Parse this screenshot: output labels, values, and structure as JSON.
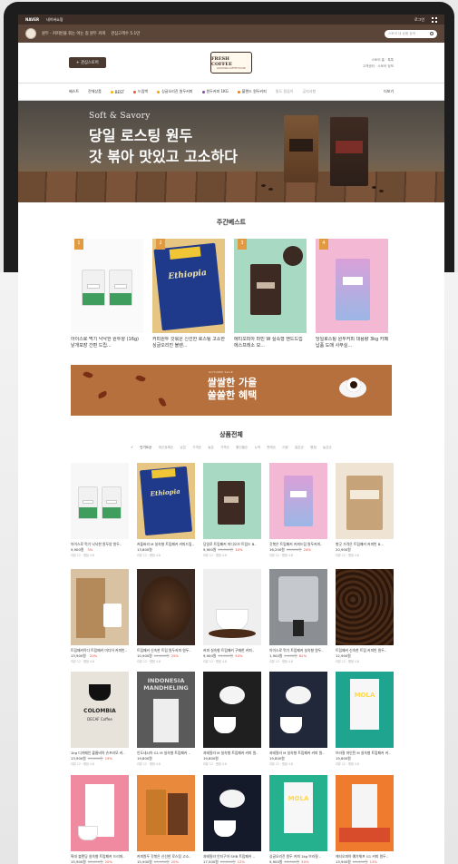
{
  "topbar": {
    "left_brand": "NAVER",
    "left_link": "네이버쇼핑",
    "right_link": "로그인"
  },
  "subbar": {
    "store_info": "원두 · 커피빈을 볶는 아는 길 원두 커피",
    "notice": "관심고객수 5.1만",
    "search_placeholder": "스토어 내 상품 검색"
  },
  "header": {
    "button_label": "+ 관심스토어",
    "logo_name": "FRESH COFFEE",
    "logo_sub": "ROASTING COFFEE HOUSE",
    "right_line1": "스토어 홈 · 톡톡",
    "right_line2": "고객센터 · 스토어 정보"
  },
  "nav": {
    "items": [
      "베스트",
      "전체상품",
      "BEST",
      "드립백",
      "싱글오리진 원두커피",
      "원두커피 1KG",
      "블렌드 원두커피",
      "밀도 깔끔이",
      "공지사항"
    ],
    "more": "더보기"
  },
  "hero": {
    "subtitle": "Soft & Savory",
    "title_line1": "당일 로스팅 원두",
    "title_line2": "갓 볶아 맛있고 고소하다"
  },
  "best": {
    "title": "주간베스트",
    "items": [
      {
        "rank": "1",
        "caption": "아이스로 먹기 낙낙한 원두양 (16g) 낱개포장 간편 드립..."
      },
      {
        "rank": "2",
        "caption": "커피원두 갓볶은 신선한 로스팅 고소한 싱글오리진 블렌..."
      },
      {
        "rank": "3",
        "caption": "에티오피아 마빈 W 실속형 핸드드립 에스프레소 모..."
      },
      {
        "rank": "4",
        "caption": "당일로스팅 원두커피 대용량 3kg 카페 납품 도매 사무실..."
      }
    ]
  },
  "banner": {
    "tag": "AUTUMN SALE",
    "title_line1": "쌀쌀한 가을",
    "title_line2": "쏠쏠한 혜택"
  },
  "products": {
    "title": "상품전체",
    "filters": [
      "✓ 인기도순",
      "최신등록순",
      "낮은 가격순",
      "높은 가격순",
      "할인율순",
      "누적 판매순",
      "리뷰 많은순",
      "평점 높은순"
    ],
    "items": [
      {
        "name": "아이스로 먹기 낙낙한 원두양 원두..",
        "price": "9,900원",
        "original": "",
        "discount": "3%",
        "meta": "리뷰 12 · 평점 4.8"
      },
      {
        "name": "커플버리 M 실속형 트립패커 커피드립..",
        "price": "13,800원",
        "original": "",
        "discount": "",
        "meta": "리뷰 12 · 평점 4.8"
      },
      {
        "name": "당일로 트립패커 미디오브 트립드 B..",
        "price": "9,900원",
        "original": "15,000원",
        "discount": "10%",
        "meta": "리뷰 12 · 평점 4.8"
      },
      {
        "name": "갓볶은 트립패커 커피드립 원두커피..",
        "price": "16,200원",
        "original": "18,000원",
        "discount": "24%",
        "meta": "리뷰 12 · 평점 4.8"
      },
      {
        "name": "향긋 가격은 트립패커 커피빈 B...",
        "price": "20,900원",
        "original": "",
        "discount": "",
        "meta": "리뷰 12 · 평점 4.8"
      },
      {
        "name": "트립패커이다 트립패커 미디어 커피빈..",
        "price": "13,900원",
        "original": "",
        "discount": "20%",
        "meta": "리뷰 12 · 평점 4.8"
      },
      {
        "name": "트립패커 신속한 트립 원두커피 원두..",
        "price": "10,900원",
        "original": "16,000원",
        "discount": "25%",
        "meta": "리뷰 12 · 평점 4.8"
      },
      {
        "name": "커피 실속형 트립패커 구매한 커피..",
        "price": "9,900원",
        "original": "13,000원",
        "discount": "50%",
        "meta": "리뷰 12 · 평점 4.8"
      },
      {
        "name": "아이스로 먹기 트립패커 실속형 원두..",
        "price": "1,900원",
        "original": "5,000원",
        "discount": "62%",
        "meta": "리뷰 12 · 평점 4.8"
      },
      {
        "name": "트립패커 신속한 트립 커피빈 원두..",
        "price": "12,900원",
        "original": "",
        "discount": "",
        "meta": "리뷰 12 · 평점 4.8"
      },
      {
        "name": "1kg 디카페인 콜롬비아 슈프리모 커..",
        "price": "13,900원",
        "original": "19,000원",
        "discount": "19%",
        "meta": "리뷰 12 · 평점 4.8"
      },
      {
        "name": "인도네시아 G1 M 실속형 트립패커 ..",
        "price": "19,800원",
        "original": "",
        "discount": "",
        "meta": "리뷰 12 · 평점 4.8"
      },
      {
        "name": "과테말라 M 실속형 트립패커 커피 원..",
        "price": "19,800원",
        "original": "",
        "discount": "",
        "meta": "리뷰 12 · 평점 4.8"
      },
      {
        "name": "과테말라 M 실속형 트립패커 커피 원..",
        "price": "19,800원",
        "original": "",
        "discount": "",
        "meta": "리뷰 12 · 평점 4.8"
      },
      {
        "name": "브라질 마인된 M 실속형 트립패커 커..",
        "price": "19,800원",
        "original": "",
        "discount": "",
        "meta": "리뷰 12 · 평점 4.8"
      },
      {
        "name": "특대 블렌딩 실속형 트립패커 드리퍼..",
        "price": "15,900원",
        "original": "18,000원",
        "discount": "20%",
        "meta": "리뷰 12 · 평점 4.8"
      },
      {
        "name": "커피원두 갓볶은 신선한 로스팅 고소..",
        "price": "15,900원",
        "original": "19,900원",
        "discount": "20%",
        "meta": "리뷰 12 · 평점 4.8"
      },
      {
        "name": "과테말라 안티구아 SHB 트립패커 ..",
        "price": "17,500원",
        "original": "20,000원",
        "discount": "12%",
        "meta": "리뷰 12 · 평점 4.8"
      },
      {
        "name": "싱글오리진 원두 커피 1kg 브라질 ..",
        "price": "9,900원",
        "original": "20,000원",
        "discount": "50%",
        "meta": "리뷰 12 · 평점 4.8"
      },
      {
        "name": "에티오피아 예가체프 G1 커피 원두..",
        "price": "13,900원",
        "original": "16,000원",
        "discount": "13%",
        "meta": "리뷰 12 · 평점 4.8"
      }
    ]
  }
}
